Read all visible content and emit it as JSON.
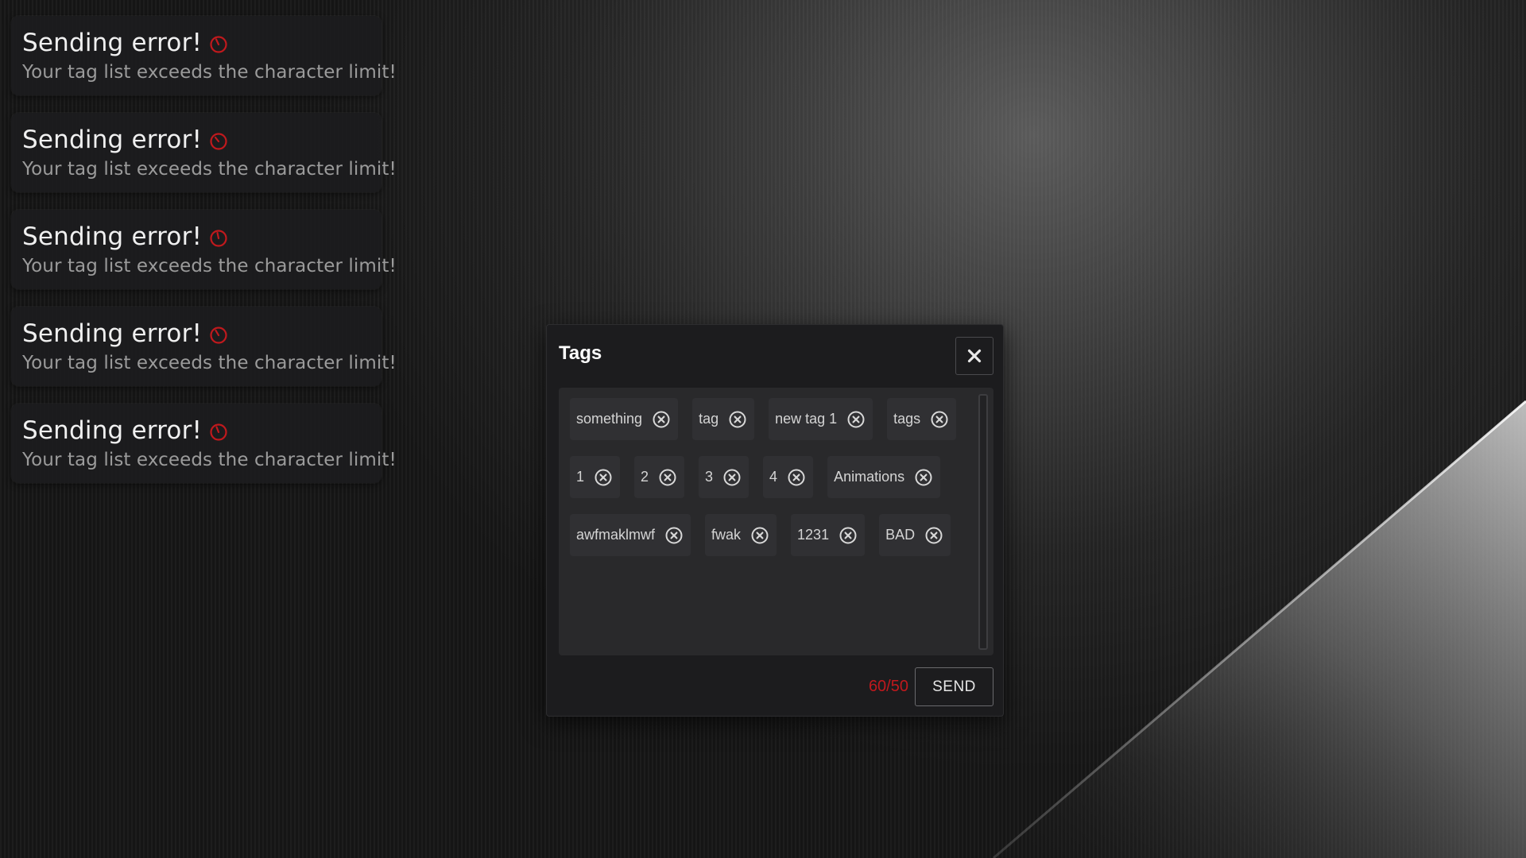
{
  "colors": {
    "error_red": "#c0191d",
    "modal_bg": "#1c1c1e",
    "tag_area_bg": "#29292b",
    "tag_bg": "#303033",
    "toast_bg": "#1c1c1e"
  },
  "toasts": [
    {
      "title": "Sending error!",
      "message": "Your tag list exceeds the character limit!",
      "icon": "error-timer-icon"
    },
    {
      "title": "Sending error!",
      "message": "Your tag list exceeds the character limit!",
      "icon": "error-timer-icon"
    },
    {
      "title": "Sending error!",
      "message": "Your tag list exceeds the character limit!",
      "icon": "error-timer-icon"
    },
    {
      "title": "Sending error!",
      "message": "Your tag list exceeds the character limit!",
      "icon": "error-timer-icon"
    },
    {
      "title": "Sending error!",
      "message": "Your tag list exceeds the character limit!",
      "icon": "error-timer-icon"
    }
  ],
  "modal": {
    "title": "Tags",
    "close_icon": "close-icon",
    "tags": [
      "something",
      "tag",
      "new tag 1",
      "tags",
      "1",
      "2",
      "3",
      "4",
      "Animations",
      "awfmaklmwf",
      "fwak",
      "1231",
      "BAD"
    ],
    "tag_remove_icon": "circle-x-icon",
    "char_count": "60/50",
    "send_label": "SEND"
  }
}
